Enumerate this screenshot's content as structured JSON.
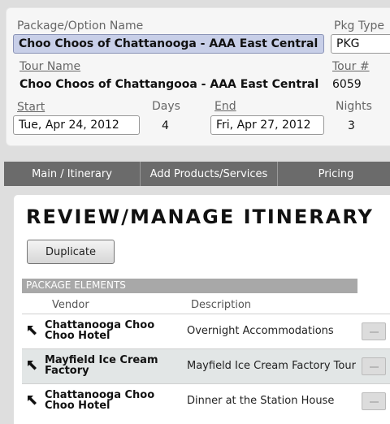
{
  "package": {
    "name_label": "Package/Option Name",
    "name_value": "Choo Choos of Chattanooga - AAA East Central",
    "type_label": "Pkg Type",
    "type_value": "PKG"
  },
  "tour": {
    "name_label": "Tour Name",
    "name_value": "Choo Choos of Chattangooa - AAA East Central",
    "number_label": "Tour #",
    "number_value": "6059"
  },
  "dates": {
    "start_label": "Start",
    "start_value": "Tue, Apr 24, 2012",
    "days_label": "Days",
    "days_value": "4",
    "end_label": "End",
    "end_value": "Fri, Apr 27, 2012",
    "nights_label": "Nights",
    "nights_value": "3"
  },
  "tabs": [
    {
      "label": "Main / Itinerary"
    },
    {
      "label": "Add Products/Services"
    },
    {
      "label": "Pricing"
    }
  ],
  "main": {
    "title": "REVIEW/MANAGE ITINERARY",
    "duplicate_label": "Duplicate",
    "section_label": "PACKAGE ELEMENTS",
    "col_vendor": "Vendor",
    "col_description": "Description",
    "elements": [
      {
        "vendor": "Chattanooga Choo Choo Hotel",
        "description": "Overnight Accommodations"
      },
      {
        "vendor": "Mayfield Ice Cream Factory",
        "description": "Mayfield Ice Cream Factory Tour"
      },
      {
        "vendor": "Chattanooga Choo Choo Hotel",
        "description": "Dinner at the Station House"
      }
    ]
  },
  "colors": {
    "selected_field": "#c8cfe8",
    "tab_bar": "#6b6b6b",
    "section_bar": "#a8a8a8",
    "alt_row": "#e2e6e6"
  }
}
